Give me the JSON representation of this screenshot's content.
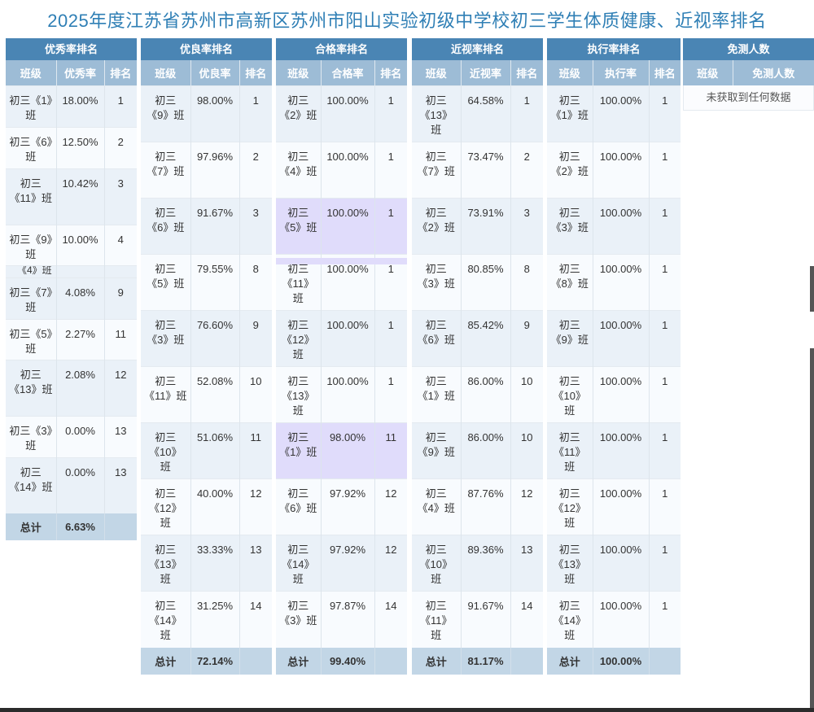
{
  "title": "2025年度江苏省苏州市高新区苏州市阳山实验初级中学校初三学生体质健康、近视率排名",
  "colors": {
    "header": "#4a85b4",
    "subheader": "#9dbcd6",
    "total_row": "#c2d6e6",
    "highlight": "#e0dcfb",
    "title": "#2f7fb5"
  },
  "panels": [
    {
      "header": "优秀率排名",
      "columns": [
        "班级",
        "优秀率",
        "排名"
      ],
      "rows": [
        {
          "class": "初三《1》班",
          "value": "18.00%",
          "rank": "1"
        },
        {
          "class": "初三《6》班",
          "value": "12.50%",
          "rank": "2"
        },
        {
          "class": "初三《11》班",
          "value": "10.42%",
          "rank": "3"
        },
        {
          "class": "初三《9》班",
          "value": "10.00%",
          "rank": "4"
        },
        {
          "class": "初三《7》班",
          "value": "4.08%",
          "rank": "9"
        },
        {
          "class": "初三《5》班",
          "value": "2.27%",
          "rank": "11"
        },
        {
          "class": "初三《13》班",
          "value": "2.08%",
          "rank": "12"
        },
        {
          "class": "初三《3》班",
          "value": "0.00%",
          "rank": "13"
        },
        {
          "class": "初三《14》班",
          "value": "0.00%",
          "rank": "13"
        }
      ],
      "total_label": "总计",
      "total_value": "6.63%",
      "overlap_text": "《4》班"
    },
    {
      "header": "优良率排名",
      "columns": [
        "班级",
        "优良率",
        "排名"
      ],
      "rows": [
        {
          "class": "初三《9》班",
          "value": "98.00%",
          "rank": "1"
        },
        {
          "class": "初三《7》班",
          "value": "97.96%",
          "rank": "2"
        },
        {
          "class": "初三《6》班",
          "value": "91.67%",
          "rank": "3"
        },
        {
          "class": "初三《5》班",
          "value": "79.55%",
          "rank": "8"
        },
        {
          "class": "初三《3》班",
          "value": "76.60%",
          "rank": "9"
        },
        {
          "class": "初三《11》班",
          "value": "52.08%",
          "rank": "10"
        },
        {
          "class": "初三《10》班",
          "value": "51.06%",
          "rank": "11"
        },
        {
          "class": "初三《12》班",
          "value": "40.00%",
          "rank": "12"
        },
        {
          "class": "初三《13》班",
          "value": "33.33%",
          "rank": "13"
        },
        {
          "class": "初三《14》班",
          "value": "31.25%",
          "rank": "14"
        }
      ],
      "total_label": "总计",
      "total_value": "72.14%"
    },
    {
      "header": "合格率排名",
      "columns": [
        "班级",
        "合格率",
        "排名"
      ],
      "rows": [
        {
          "class": "初三《2》班",
          "value": "100.00%",
          "rank": "1"
        },
        {
          "class": "初三《4》班",
          "value": "100.00%",
          "rank": "1"
        },
        {
          "class": "初三《5》班",
          "value": "100.00%",
          "rank": "1",
          "highlight": true
        },
        {
          "class": "初三《11》班",
          "value": "100.00%",
          "rank": "1"
        },
        {
          "class": "初三《12》班",
          "value": "100.00%",
          "rank": "1"
        },
        {
          "class": "初三《13》班",
          "value": "100.00%",
          "rank": "1"
        },
        {
          "class": "初三《1》班",
          "value": "98.00%",
          "rank": "11",
          "highlight": true
        },
        {
          "class": "初三《6》班",
          "value": "97.92%",
          "rank": "12"
        },
        {
          "class": "初三《14》班",
          "value": "97.92%",
          "rank": "12"
        },
        {
          "class": "初三《3》班",
          "value": "97.87%",
          "rank": "14"
        }
      ],
      "total_label": "总计",
      "total_value": "99.40%"
    },
    {
      "header": "近视率排名",
      "columns": [
        "班级",
        "近视率",
        "排名"
      ],
      "rows": [
        {
          "class": "初三《13》班",
          "value": "64.58%",
          "rank": "1"
        },
        {
          "class": "初三《7》班",
          "value": "73.47%",
          "rank": "2"
        },
        {
          "class": "初三《2》班",
          "value": "73.91%",
          "rank": "3"
        },
        {
          "class": "初三《3》班",
          "value": "80.85%",
          "rank": "8"
        },
        {
          "class": "初三《6》班",
          "value": "85.42%",
          "rank": "9"
        },
        {
          "class": "初三《1》班",
          "value": "86.00%",
          "rank": "10"
        },
        {
          "class": "初三《9》班",
          "value": "86.00%",
          "rank": "10"
        },
        {
          "class": "初三《4》班",
          "value": "87.76%",
          "rank": "12"
        },
        {
          "class": "初三《10》班",
          "value": "89.36%",
          "rank": "13"
        },
        {
          "class": "初三《11》班",
          "value": "91.67%",
          "rank": "14"
        }
      ],
      "total_label": "总计",
      "total_value": "81.17%"
    },
    {
      "header": "执行率排名",
      "columns": [
        "班级",
        "执行率",
        "排名"
      ],
      "rows": [
        {
          "class": "初三《1》班",
          "value": "100.00%",
          "rank": "1"
        },
        {
          "class": "初三《2》班",
          "value": "100.00%",
          "rank": "1"
        },
        {
          "class": "初三《3》班",
          "value": "100.00%",
          "rank": "1"
        },
        {
          "class": "初三《8》班",
          "value": "100.00%",
          "rank": "1"
        },
        {
          "class": "初三《9》班",
          "value": "100.00%",
          "rank": "1"
        },
        {
          "class": "初三《10》班",
          "value": "100.00%",
          "rank": "1"
        },
        {
          "class": "初三《11》班",
          "value": "100.00%",
          "rank": "1"
        },
        {
          "class": "初三《12》班",
          "value": "100.00%",
          "rank": "1"
        },
        {
          "class": "初三《13》班",
          "value": "100.00%",
          "rank": "1"
        },
        {
          "class": "初三《14》班",
          "value": "100.00%",
          "rank": "1"
        }
      ],
      "total_label": "总计",
      "total_value": "100.00%"
    },
    {
      "header": "免测人数",
      "columns": [
        "班级",
        "免测人数"
      ],
      "empty_text": "未获取到任何数据"
    }
  ]
}
